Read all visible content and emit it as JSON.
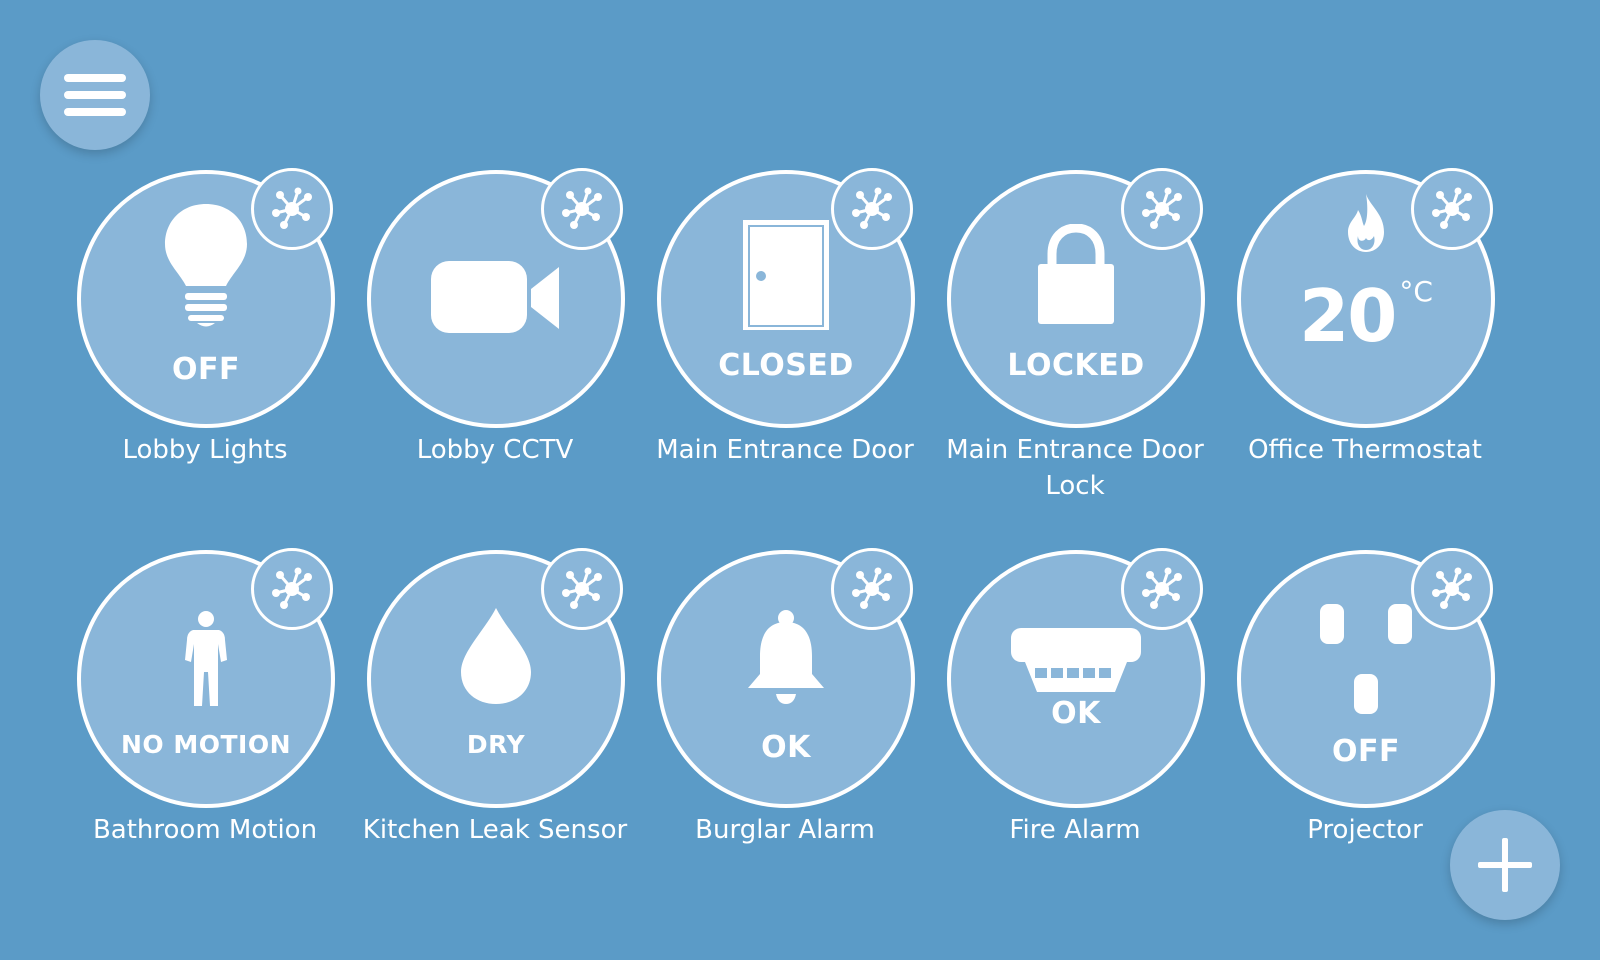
{
  "devices": [
    {
      "name": "Lobby Lights",
      "status": "OFF",
      "icon": "lightbulb-icon"
    },
    {
      "name": "Lobby CCTV",
      "status": "",
      "icon": "video-camera-icon"
    },
    {
      "name": "Main Entrance Door",
      "status": "CLOSED",
      "icon": "door-icon"
    },
    {
      "name": "Main Entrance Door Lock",
      "status": "LOCKED",
      "icon": "padlock-icon"
    },
    {
      "name": "Office Thermostat",
      "temperature": "20",
      "unit": "°C",
      "icon": "flame-icon"
    },
    {
      "name": "Bathroom Motion",
      "status": "NO MOTION",
      "icon": "person-icon"
    },
    {
      "name": "Kitchen Leak Sensor",
      "status": "DRY",
      "icon": "water-drop-icon"
    },
    {
      "name": "Burglar Alarm",
      "status": "OK",
      "icon": "bell-icon"
    },
    {
      "name": "Fire Alarm",
      "status": "OK",
      "icon": "smoke-detector-icon"
    },
    {
      "name": "Projector",
      "status": "OFF",
      "icon": "power-outlet-icon"
    }
  ],
  "controls": {
    "menu_icon": "hamburger-menu-icon",
    "add_icon": "plus-icon",
    "hub_icon": "network-hub-icon"
  },
  "colors": {
    "background": "#5b9bc7",
    "tile": "#8ab6d9",
    "foreground": "#ffffff"
  }
}
